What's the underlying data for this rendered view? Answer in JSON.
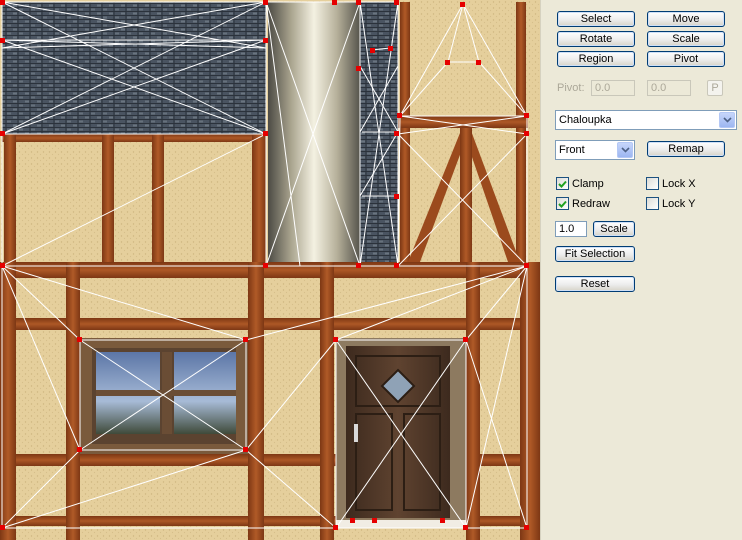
{
  "toolbar": {
    "select": "Select",
    "move": "Move",
    "rotate": "Rotate",
    "scale": "Scale",
    "region": "Region",
    "pivot": "Pivot"
  },
  "pivot": {
    "label": "Pivot:",
    "x_value": "0.0",
    "y_value": "0.0",
    "button": "P",
    "enabled": false
  },
  "texture_select": {
    "selected": "Chaloupka"
  },
  "view_select": {
    "selected": "Front"
  },
  "remap_button": "Remap",
  "options": {
    "clamp": {
      "label": "Clamp",
      "checked": true
    },
    "redraw": {
      "label": "Redraw",
      "checked": true
    },
    "lock_x": {
      "label": "Lock X",
      "checked": false
    },
    "lock_y": {
      "label": "Lock Y",
      "checked": false
    }
  },
  "scale_value": "1.0",
  "scale_button": "Scale",
  "fit_selection_button": "Fit Selection",
  "reset_button": "Reset",
  "colors": {
    "plaster": "#e6d09e",
    "timber": "#9b4a1d",
    "roof": "#4c5662",
    "uv_line": "#ffffff",
    "uv_vertex": "#e60000",
    "panel_bg": "#ece9d8",
    "button_border": "#003c74"
  },
  "icons": {
    "dropdown": "chevron-down-icon",
    "checkmark": "checkmark-icon"
  }
}
